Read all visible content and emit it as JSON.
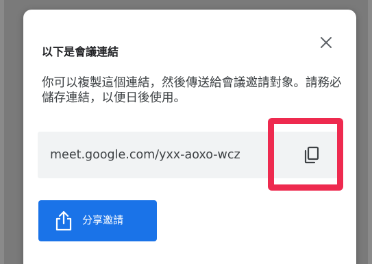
{
  "dialog": {
    "title": "以下是會議連結",
    "body": "你可以複製這個連結，然後傳送給會議邀請對象。請務必儲存連結，以便日後使用。",
    "link": "meet.google.com/yxx-aoxo-wcz",
    "share_label": "分享邀請"
  },
  "icons": {
    "close": "close-icon",
    "copy": "copy-icon",
    "share": "share-icon"
  },
  "colors": {
    "accent": "#1a73e8",
    "highlight": "#ee2a4f",
    "link_box_bg": "#f1f3f4",
    "backdrop": "#7a7a7a"
  }
}
